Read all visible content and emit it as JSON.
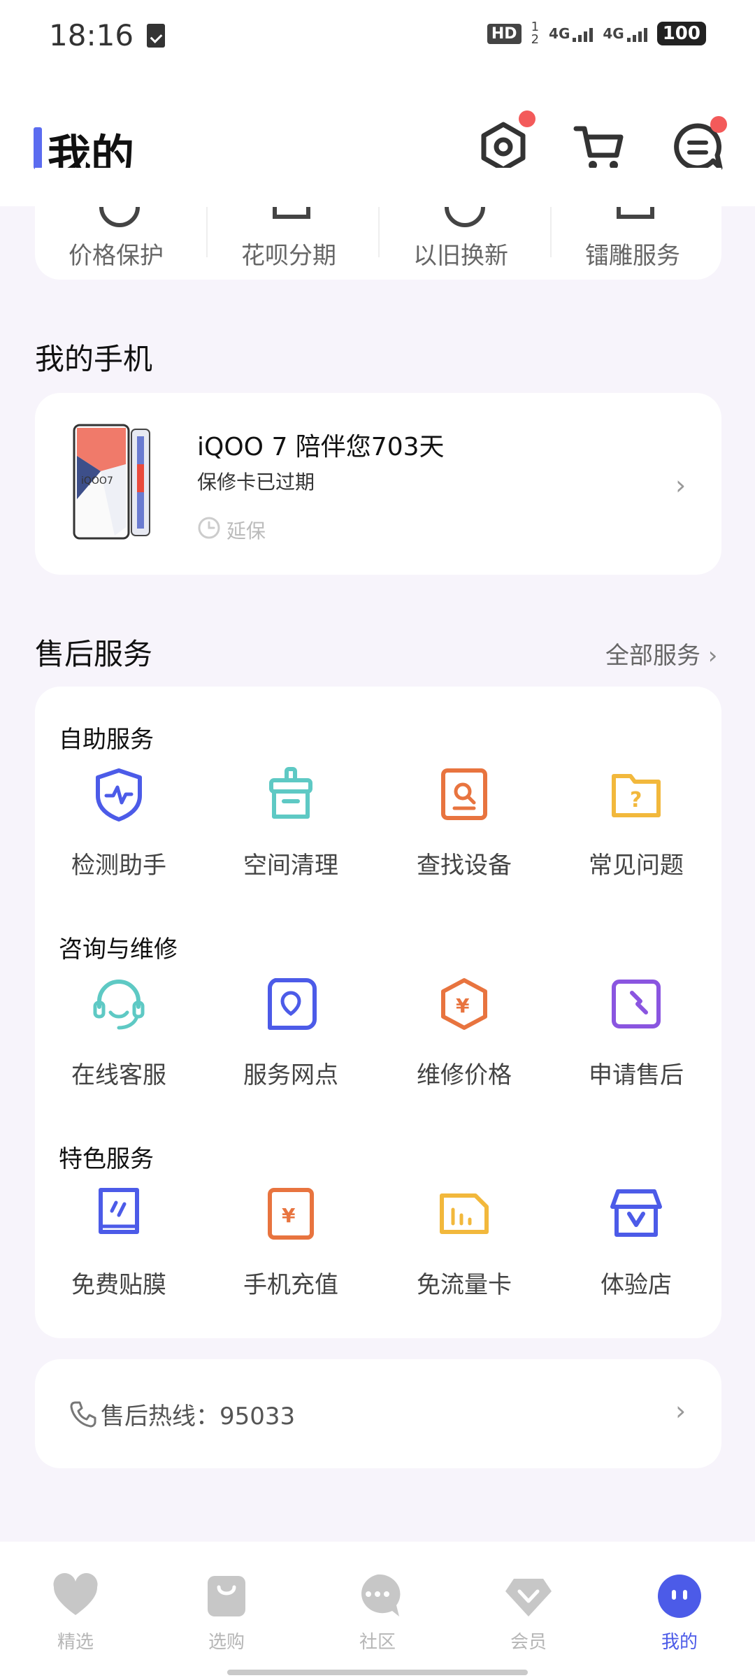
{
  "status_bar": {
    "time": "18:16",
    "hd": "HD",
    "sim_top": "1",
    "sim_bottom": "2",
    "net1": "4G",
    "net2": "4G",
    "battery": "100"
  },
  "header": {
    "title": "我的",
    "icons": [
      "settings-icon",
      "cart-icon",
      "message-icon"
    ],
    "accent_color": "#5b6cf0",
    "badge_color": "#f35a5a"
  },
  "top_services": [
    "价格保护",
    "花呗分期",
    "以旧换新",
    "镭雕服务"
  ],
  "my_phone": {
    "section_title": "我的手机",
    "model_line": "iQOO 7 陪伴您703天",
    "warranty_status": "保修卡已过期",
    "extend_label": "延保",
    "device_label": "iQOO7"
  },
  "after_sales": {
    "section_title": "售后服务",
    "all_services_label": "全部服务",
    "groups": [
      {
        "title": "自助服务",
        "items": [
          {
            "label": "检测助手",
            "icon": "shield-pulse-icon",
            "color": "#4c5be8"
          },
          {
            "label": "空间清理",
            "icon": "broom-icon",
            "color": "#5ec9c4"
          },
          {
            "label": "查找设备",
            "icon": "find-device-icon",
            "color": "#e8743f"
          },
          {
            "label": "常见问题",
            "icon": "faq-folder-icon",
            "color": "#f2b83c"
          }
        ]
      },
      {
        "title": "咨询与维修",
        "items": [
          {
            "label": "在线客服",
            "icon": "headset-icon",
            "color": "#5ec9c4"
          },
          {
            "label": "服务网点",
            "icon": "location-icon",
            "color": "#4c5be8"
          },
          {
            "label": "维修价格",
            "icon": "price-hexagon-icon",
            "color": "#e8743f"
          },
          {
            "label": "申请售后",
            "icon": "wrench-icon",
            "color": "#8a55e0"
          }
        ]
      },
      {
        "title": "特色服务",
        "items": [
          {
            "label": "免费贴膜",
            "icon": "screen-film-icon",
            "color": "#4c5be8"
          },
          {
            "label": "手机充值",
            "icon": "recharge-icon",
            "color": "#e8743f"
          },
          {
            "label": "免流量卡",
            "icon": "sim-card-icon",
            "color": "#f2b83c"
          },
          {
            "label": "体验店",
            "icon": "store-icon",
            "color": "#4c5be8"
          }
        ]
      }
    ]
  },
  "hotline": {
    "label": "售后热线：",
    "number": "95033"
  },
  "bottom_nav": {
    "items": [
      {
        "label": "精选",
        "icon": "heart-icon"
      },
      {
        "label": "选购",
        "icon": "shopping-bag-icon"
      },
      {
        "label": "社区",
        "icon": "chat-bubble-icon"
      },
      {
        "label": "会员",
        "icon": "diamond-icon"
      },
      {
        "label": "我的",
        "icon": "face-icon",
        "active": true
      }
    ]
  }
}
